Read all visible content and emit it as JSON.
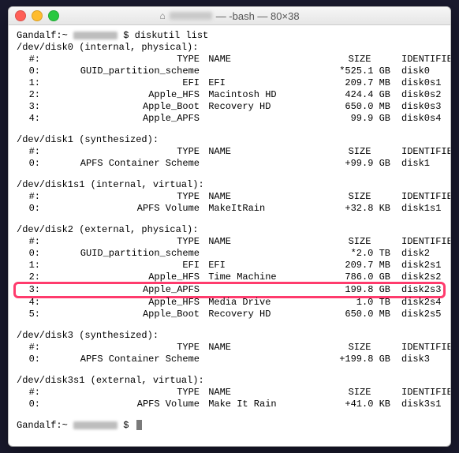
{
  "window": {
    "title_suffix": " — -bash — 80×38"
  },
  "prompt": {
    "host": "Gandalf",
    "path": "~",
    "symbol": "$",
    "command": "diskutil list"
  },
  "headers": {
    "idx": "#:",
    "type": "TYPE",
    "name": "NAME",
    "size": "SIZE",
    "identifier": "IDENTIFIER"
  },
  "disks": [
    {
      "device": "/dev/disk0",
      "qualifier": "(internal, physical):",
      "rows": [
        {
          "idx": "0:",
          "type": "GUID_partition_scheme",
          "name": "",
          "size": "*525.1 GB",
          "id": "disk0"
        },
        {
          "idx": "1:",
          "type": "EFI",
          "name": "EFI",
          "size": "209.7 MB",
          "id": "disk0s1"
        },
        {
          "idx": "2:",
          "type": "Apple_HFS",
          "name": "Macintosh HD",
          "size": "424.4 GB",
          "id": "disk0s2"
        },
        {
          "idx": "3:",
          "type": "Apple_Boot",
          "name": "Recovery HD",
          "size": "650.0 MB",
          "id": "disk0s3"
        },
        {
          "idx": "4:",
          "type": "Apple_APFS",
          "name": "",
          "size": "99.9 GB",
          "id": "disk0s4"
        }
      ]
    },
    {
      "device": "/dev/disk1",
      "qualifier": "(synthesized):",
      "rows": [
        {
          "idx": "0:",
          "type": "APFS Container Scheme",
          "name": "",
          "size": "+99.9 GB",
          "id": "disk1"
        }
      ]
    },
    {
      "device": "/dev/disk1s1",
      "qualifier": "(internal, virtual):",
      "rows": [
        {
          "idx": "0:",
          "type": "APFS Volume",
          "name": "MakeItRain",
          "size": "+32.8 KB",
          "id": "disk1s1"
        }
      ]
    },
    {
      "device": "/dev/disk2",
      "qualifier": "(external, physical):",
      "rows": [
        {
          "idx": "0:",
          "type": "GUID_partition_scheme",
          "name": "",
          "size": "*2.0 TB",
          "id": "disk2"
        },
        {
          "idx": "1:",
          "type": "EFI",
          "name": "EFI",
          "size": "209.7 MB",
          "id": "disk2s1"
        },
        {
          "idx": "2:",
          "type": "Apple_HFS",
          "name": "Time Machine",
          "size": "786.0 GB",
          "id": "disk2s2"
        },
        {
          "idx": "3:",
          "type": "Apple_APFS",
          "name": "",
          "size": "199.8 GB",
          "id": "disk2s3",
          "highlight": true
        },
        {
          "idx": "4:",
          "type": "Apple_HFS",
          "name": "Media Drive",
          "size": "1.0 TB",
          "id": "disk2s4"
        },
        {
          "idx": "5:",
          "type": "Apple_Boot",
          "name": "Recovery HD",
          "size": "650.0 MB",
          "id": "disk2s5"
        }
      ]
    },
    {
      "device": "/dev/disk3",
      "qualifier": "(synthesized):",
      "rows": [
        {
          "idx": "0:",
          "type": "APFS Container Scheme",
          "name": "",
          "size": "+199.8 GB",
          "id": "disk3"
        }
      ]
    },
    {
      "device": "/dev/disk3s1",
      "qualifier": "(external, virtual):",
      "rows": [
        {
          "idx": "0:",
          "type": "APFS Volume",
          "name": "Make It Rain",
          "size": "+41.0 KB",
          "id": "disk3s1"
        }
      ]
    }
  ],
  "colors": {
    "highlight": "#ff3b6d"
  }
}
